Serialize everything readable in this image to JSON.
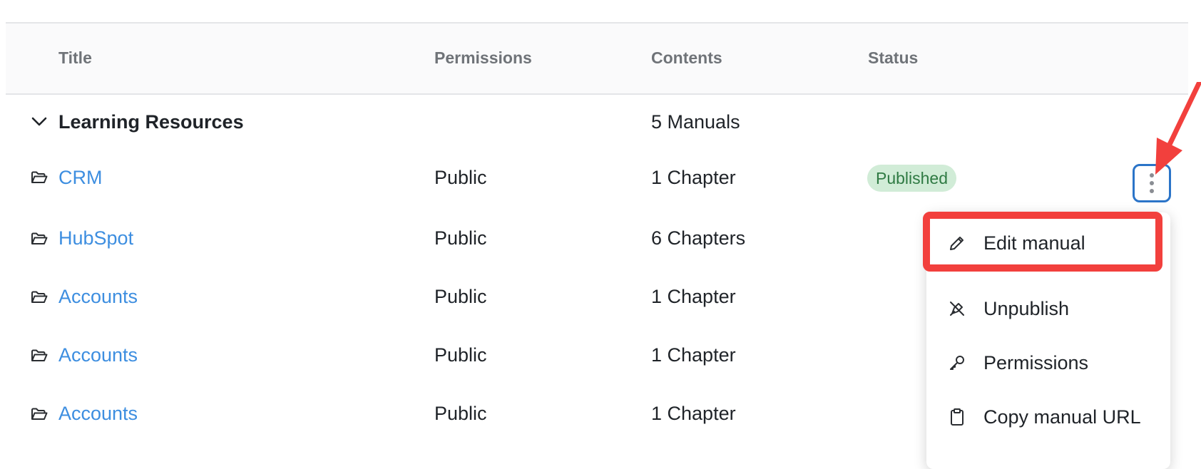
{
  "columns": {
    "title": "Title",
    "permissions": "Permissions",
    "contents": "Contents",
    "status": "Status"
  },
  "group": {
    "title": "Learning Resources",
    "contents": "5 Manuals"
  },
  "rows": [
    {
      "title": "CRM",
      "permissions": "Public",
      "contents": "1 Chapter",
      "status": "Published"
    },
    {
      "title": "HubSpot",
      "permissions": "Public",
      "contents": "6 Chapters",
      "status": ""
    },
    {
      "title": "Accounts",
      "permissions": "Public",
      "contents": "1 Chapter",
      "status": ""
    },
    {
      "title": "Accounts",
      "permissions": "Public",
      "contents": "1 Chapter",
      "status": ""
    },
    {
      "title": "Accounts",
      "permissions": "Public",
      "contents": "1 Chapter",
      "status": ""
    }
  ],
  "menu": {
    "items": [
      {
        "label": "Edit manual",
        "icon": "pencil-icon"
      },
      {
        "label": "Unpublish",
        "icon": "unpublish-icon"
      },
      {
        "label": "Permissions",
        "icon": "key-icon"
      },
      {
        "label": "Copy manual URL",
        "icon": "clipboard-icon"
      }
    ]
  },
  "colors": {
    "link": "#3d8ee0",
    "published_bg": "#d1ecd7",
    "published_text": "#2f7a43",
    "annotation": "#f2403d",
    "focus": "#2b74c8"
  }
}
